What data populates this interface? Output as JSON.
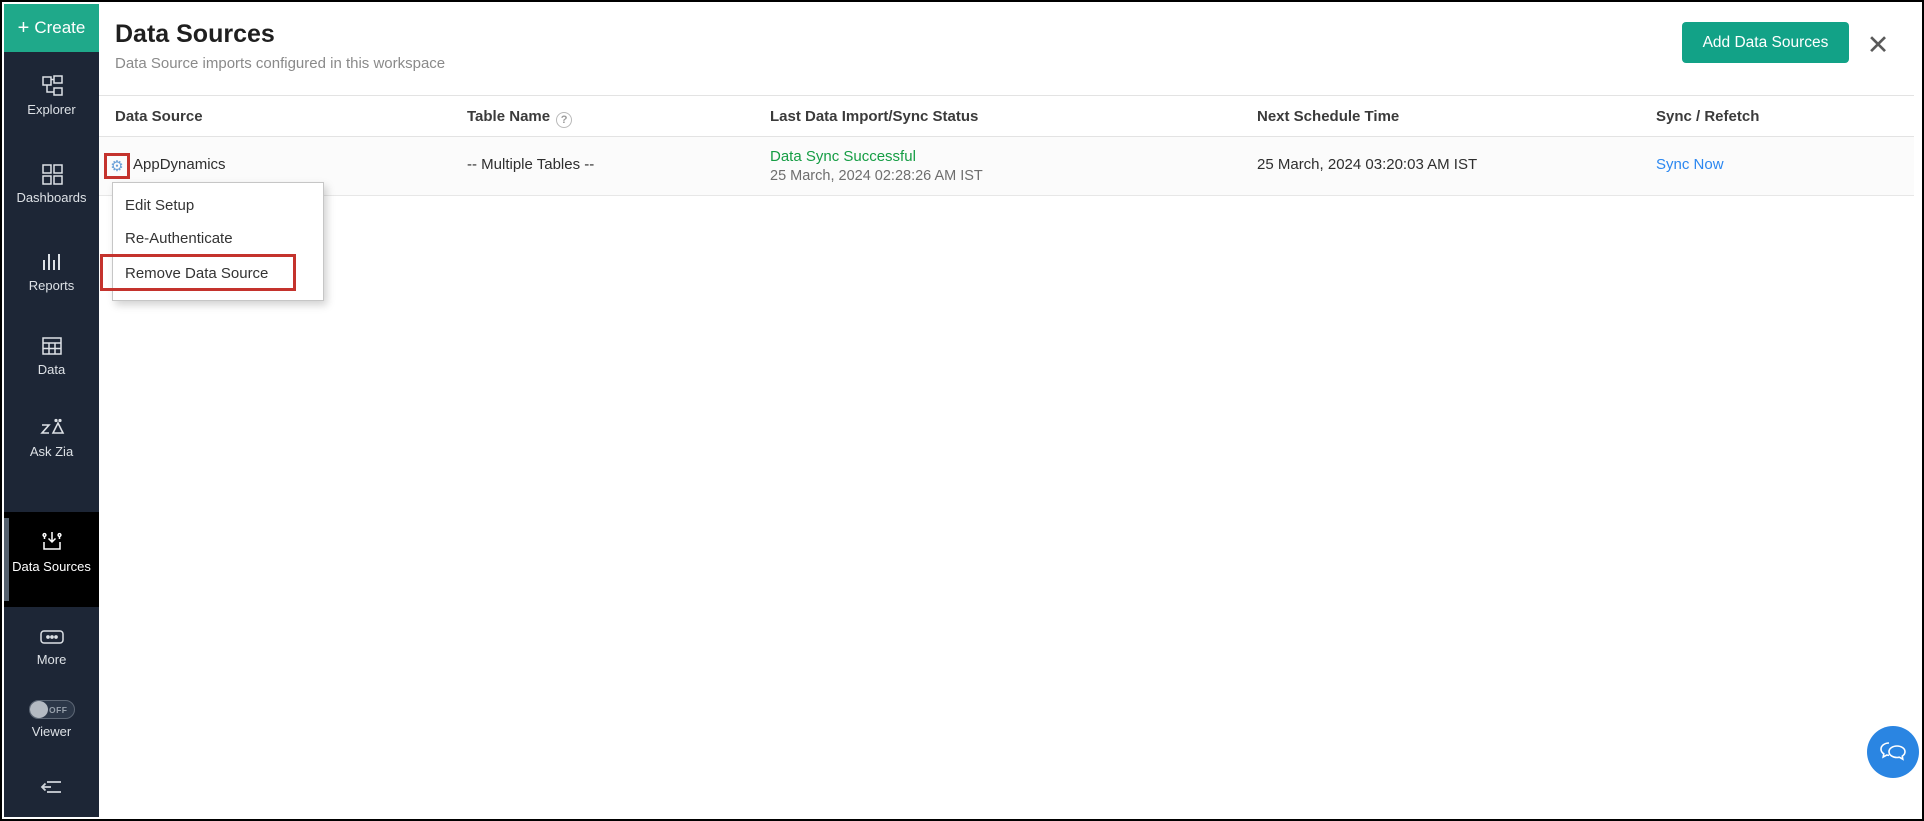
{
  "sidebar": {
    "create_label": "Create",
    "items": [
      {
        "label": "Explorer"
      },
      {
        "label": "Dashboards"
      },
      {
        "label": "Reports"
      },
      {
        "label": "Data"
      },
      {
        "label": "Ask Zia"
      },
      {
        "label": "Data Sources",
        "active": true
      },
      {
        "label": "More"
      }
    ],
    "viewer": {
      "label": "Viewer",
      "state": "OFF"
    }
  },
  "header": {
    "title": "Data Sources",
    "subtitle": "Data Source imports configured in this workspace",
    "add_button": "Add Data Sources"
  },
  "icons": {
    "plus": "+",
    "close": "✕",
    "gear": "⚙",
    "help": "?"
  },
  "table": {
    "columns": [
      "Data Source",
      "Table Name",
      "Last Data Import/Sync Status",
      "Next Schedule Time",
      "Sync / Refetch"
    ],
    "rows": [
      {
        "name": "AppDynamics",
        "table_name": "-- Multiple Tables --",
        "status": "Data Sync Successful",
        "status_time": "25 March, 2024 02:28:26 AM IST",
        "next_schedule": "25 March, 2024 03:20:03 AM IST",
        "action": "Sync Now"
      }
    ]
  },
  "context_menu": {
    "items": [
      "Edit Setup",
      "Re-Authenticate",
      "Remove Data Source"
    ],
    "highlighted_item": "Remove Data Source"
  },
  "colors": {
    "sidebar": "#1d2636",
    "create": "#1fa98a",
    "add": "#12a287",
    "ok": "#159d44",
    "link": "#2b87f0",
    "annot": "#c4332d",
    "gearblue": "#6aa0d8",
    "chat": "#2a85e2"
  }
}
